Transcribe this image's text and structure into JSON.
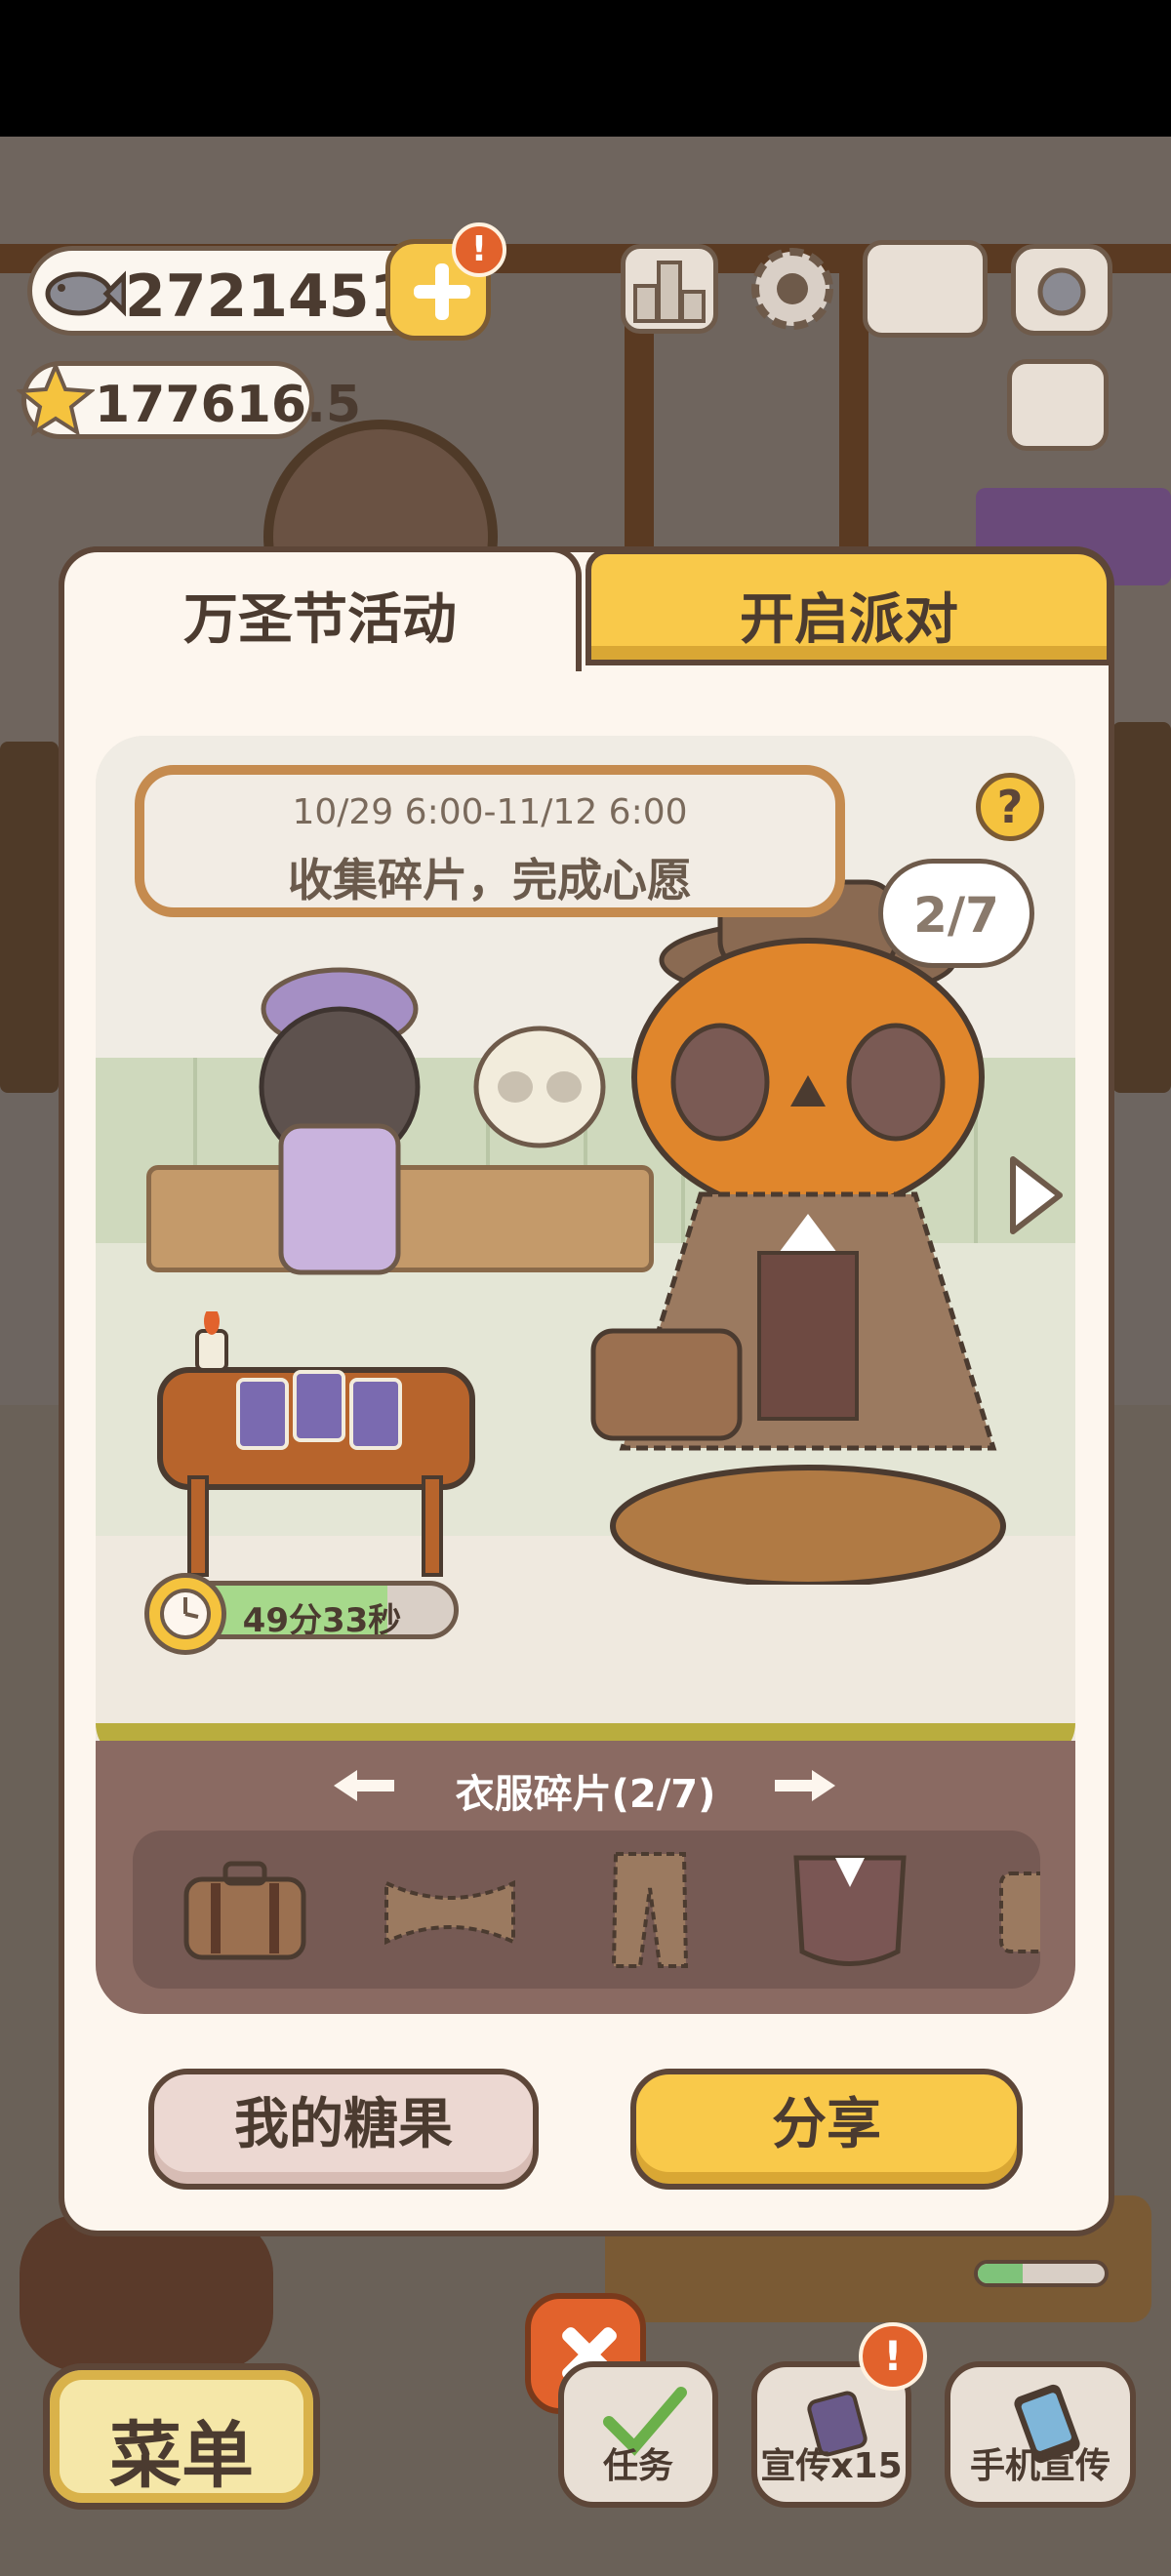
{
  "hud": {
    "fish_count": "2721451",
    "star_count": "177616.5",
    "alert_mark": "!"
  },
  "dialog": {
    "tabs": [
      {
        "label": "万圣节活动",
        "active": true
      },
      {
        "label": "开启派对",
        "active": false
      }
    ],
    "event": {
      "date_range": "10/29 6:00-11/12 6:00",
      "goal": "收集碎片，完成心愿",
      "help_mark": "?",
      "progress_bubble": "2/7",
      "timer_text": "49分33秒",
      "timer_progress": 0.78
    },
    "shards": {
      "title": "衣服碎片(2/7)",
      "items": [
        {
          "icon": "suitcase-icon",
          "collected": true
        },
        {
          "icon": "bowtie-icon",
          "collected": false
        },
        {
          "icon": "trousers-icon",
          "collected": false
        },
        {
          "icon": "vest-icon",
          "collected": true
        },
        {
          "icon": "partial-item-icon",
          "collected": false
        }
      ]
    },
    "buttons": {
      "candy_label": "我的糖果",
      "share_label": "分享"
    }
  },
  "bottom_bar": {
    "menu_label": "菜单",
    "task_label": "任务",
    "promo_label": "宣传x15",
    "phone_promo_label": "手机宣传",
    "progress": 0.35
  },
  "colors": {
    "accent_yellow": "#f9c94a",
    "outline_brown": "#5d4638",
    "alert_orange": "#e2622c",
    "panel_cream": "#fdf6ee"
  }
}
